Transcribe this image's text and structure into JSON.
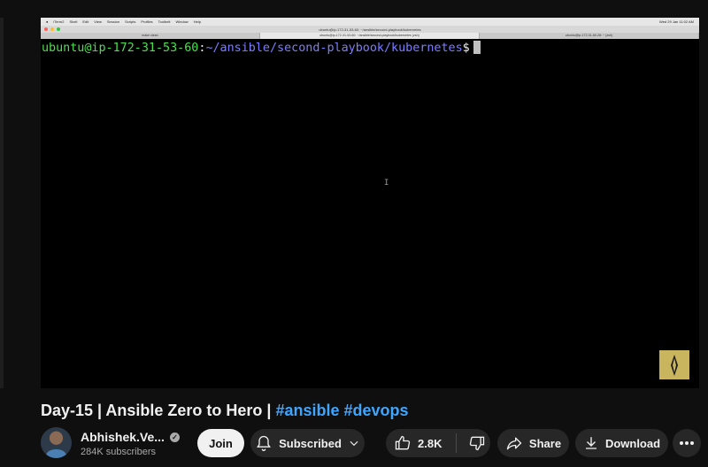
{
  "video": {
    "mac_menubar": {
      "items": [
        "iTerm2",
        "Shell",
        "Edit",
        "View",
        "Session",
        "Scripts",
        "Profiles",
        "Toolbelt",
        "Window",
        "Help"
      ],
      "clock": "Wed 29 Jan  11:02 AM"
    },
    "iterm": {
      "window_title": "ubuntu@ip-172-31-53-60: ~/ansible/second-playbook/kubernetes",
      "tabs": [
        {
          "label": "make clean"
        },
        {
          "label": "ubuntu@ip-172-31-53-60: ~/ansible/second-playbook/kubernetes (zsh)"
        },
        {
          "label": "ubuntu@ip-172-31-60-28: ~ (zsh)"
        }
      ]
    },
    "terminal": {
      "prompt_user": "ubuntu@ip-172-31-53-60",
      "prompt_colon": ":",
      "prompt_path": "~/ansible/second-playbook/kubernetes",
      "prompt_sign": "$"
    }
  },
  "title": {
    "text": "Day-15 | Ansible Zero to Hero | ",
    "tags": [
      "#ansible",
      "#devops"
    ]
  },
  "channel": {
    "name": "Abhishek.Ve...",
    "subscribers": "284K subscribers"
  },
  "actions": {
    "join": "Join",
    "subscribed": "Subscribed",
    "likes": "2.8K",
    "share": "Share",
    "download": "Download"
  },
  "colors": {
    "background": "#0f0f0f",
    "button_bg": "#272727",
    "hashtag": "#3ea6ff",
    "prompt_user": "#4ae04a",
    "prompt_path": "#7d7dff",
    "badge": "#c9b55d"
  }
}
